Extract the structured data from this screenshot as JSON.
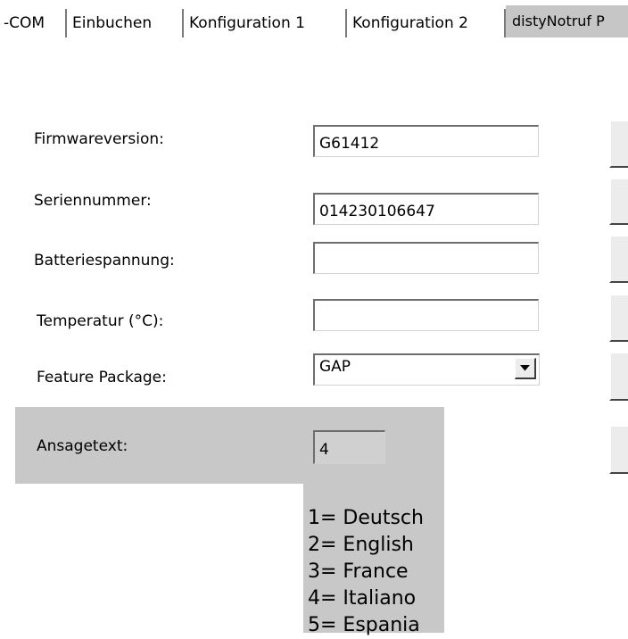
{
  "tabs": [
    {
      "label": "-COM"
    },
    {
      "label": "Einbuchen"
    },
    {
      "label": "Konfiguration 1"
    },
    {
      "label": "Konfiguration 2"
    },
    {
      "label": "distyNotruf P"
    }
  ],
  "form": {
    "firmware_label": "Firmwareversion:",
    "firmware_value": "G61412",
    "serial_label": "Seriennummer:",
    "serial_value": "014230106647",
    "battery_label": "Batteriespannung:",
    "battery_value": "",
    "temperature_label": "Temperatur (°C):",
    "temperature_value": "",
    "feature_label": "Feature Package:",
    "feature_value": "GAP",
    "announce_label": "Ansagetext:",
    "announce_value": "4"
  },
  "languages": [
    "1= Deutsch",
    "2= English",
    "3= France",
    "4= Italiano",
    "5= Espania"
  ],
  "icons": {
    "dropdown": "chevron-down-icon"
  }
}
